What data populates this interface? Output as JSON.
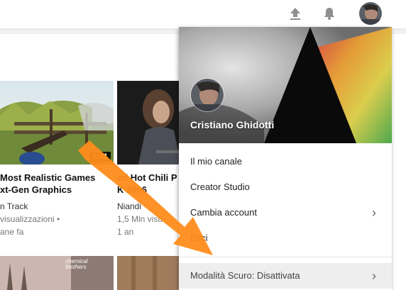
{
  "topbar": {
    "upload_icon": "upload-icon",
    "bell_icon": "bell-icon"
  },
  "videos": [
    {
      "title_line1": "Most Realistic Games",
      "title_line2": "xt-Gen Graphics",
      "duration": "1:41",
      "channel": "n Track",
      "views": "visualizzazioni •",
      "age": "ane fa"
    },
    {
      "title_line1": "ed Hot Chili P",
      "title_line2": "K 2006",
      "channel": "Niandi",
      "views": "1,5 Mln visu",
      "age": "1 an"
    }
  ],
  "bottom_thumb_text": "chemical brothers",
  "account_menu": {
    "user_name": "Cristiano Ghidotti",
    "items": [
      {
        "label": "Il mio canale"
      },
      {
        "label": "Creator Studio"
      },
      {
        "label": "Cambia account",
        "chevron": "›"
      },
      {
        "label": "Esci"
      }
    ],
    "dark_mode": {
      "label": "Modalità Scuro: Disattivata",
      "chevron": "›"
    }
  },
  "colors": {
    "arrow": "#ff8c1a",
    "dark_mode_bg": "#eeeeee"
  }
}
